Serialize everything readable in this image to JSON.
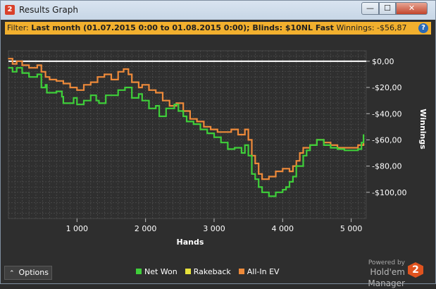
{
  "window": {
    "title": "Results Graph",
    "app_icon": "2",
    "controls": {
      "minimize": "—",
      "maximize": "☐",
      "close": "✕"
    }
  },
  "filter": {
    "prefix": "Filter:",
    "main": "Last month (01.07.2015 0:00 to 01.08.2015 0:00); Blinds: $10NL Fast",
    "winnings_label": "Winnings:",
    "winnings_value": "-$56,87",
    "help_icon": "?"
  },
  "footer": {
    "options_label": "Options",
    "powered_by": "Powered by",
    "brand": "Hold'em Manager",
    "logo": "2"
  },
  "colors": {
    "net_won": "#3fcf3a",
    "rakeback": "#e7e23c",
    "all_in_ev": "#ee8a3a",
    "zero_line": "#ffffff",
    "plot_bg": "#2f2f2f",
    "grid": "#555555",
    "filter_bg": "#f2b02e"
  },
  "chart_data": {
    "type": "line",
    "xlabel": "Hands",
    "ylabel": "Winnings",
    "xlim": [
      0,
      5220
    ],
    "ylim": [
      -120,
      8
    ],
    "x_ticks": [
      1000,
      2000,
      3000,
      4000,
      5000
    ],
    "x_tick_labels": [
      "1 000",
      "2 000",
      "3 000",
      "4 000",
      "5 000"
    ],
    "y_ticks": [
      0,
      -20,
      -40,
      -60,
      -80,
      -100
    ],
    "y_tick_labels": [
      "$0,00",
      "-$20,00",
      "-$40,00",
      "-$60,00",
      "-$80,00",
      "-$100,00"
    ],
    "grid": true,
    "legend_position": "bottom",
    "y_axis_position": "right",
    "series": [
      {
        "name": "Net Won",
        "color_key": "net_won",
        "x": [
          0,
          60,
          120,
          200,
          300,
          420,
          480,
          540,
          560,
          700,
          780,
          800,
          950,
          1000,
          1100,
          1200,
          1280,
          1320,
          1420,
          1600,
          1700,
          1800,
          1900,
          1950,
          2050,
          2150,
          2200,
          2300,
          2420,
          2480,
          2550,
          2600,
          2700,
          2800,
          2900,
          3000,
          3100,
          3200,
          3300,
          3400,
          3450,
          3500,
          3550,
          3600,
          3650,
          3700,
          3800,
          3900,
          4000,
          4050,
          4100,
          4150,
          4200,
          4300,
          4350,
          4400,
          4500,
          4600,
          4700,
          4800,
          4900,
          5000,
          5100,
          5150,
          5180
        ],
        "values": [
          -5,
          -8,
          -5,
          -9,
          -12,
          -10,
          -20,
          -18,
          -24,
          -23,
          -27,
          -32,
          -28,
          -33,
          -30,
          -26,
          -30,
          -32,
          -26,
          -22,
          -20,
          -28,
          -25,
          -30,
          -36,
          -34,
          -42,
          -36,
          -33,
          -38,
          -42,
          -46,
          -48,
          -52,
          -55,
          -58,
          -62,
          -67,
          -66,
          -70,
          -64,
          -72,
          -86,
          -90,
          -96,
          -100,
          -103,
          -100,
          -98,
          -96,
          -92,
          -88,
          -80,
          -72,
          -68,
          -64,
          -60,
          -64,
          -66,
          -67,
          -68,
          -68,
          -67,
          -62,
          -56
        ]
      },
      {
        "name": "Rakeback",
        "color_key": "rakeback",
        "x": [],
        "values": []
      },
      {
        "name": "All-In EV",
        "color_key": "all_in_ev",
        "x": [
          0,
          60,
          120,
          200,
          300,
          420,
          480,
          540,
          600,
          700,
          800,
          900,
          1000,
          1100,
          1200,
          1300,
          1400,
          1500,
          1600,
          1680,
          1750,
          1800,
          1900,
          1950,
          2050,
          2150,
          2250,
          2350,
          2450,
          2550,
          2650,
          2750,
          2850,
          2950,
          3050,
          3150,
          3250,
          3350,
          3450,
          3500,
          3550,
          3600,
          3650,
          3700,
          3800,
          3900,
          4000,
          4100,
          4150,
          4200,
          4250,
          4300,
          4400,
          4500,
          4600,
          4700,
          4800,
          4900,
          5000,
          5100,
          5150,
          5180
        ],
        "values": [
          2,
          -2,
          0,
          -3,
          -5,
          -3,
          -8,
          -12,
          -14,
          -15,
          -17,
          -20,
          -22,
          -18,
          -16,
          -12,
          -10,
          -14,
          -8,
          -6,
          -10,
          -16,
          -20,
          -18,
          -22,
          -24,
          -30,
          -34,
          -32,
          -38,
          -44,
          -46,
          -50,
          -52,
          -54,
          -54,
          -52,
          -56,
          -52,
          -60,
          -72,
          -78,
          -86,
          -90,
          -88,
          -84,
          -82,
          -84,
          -80,
          -76,
          -70,
          -66,
          -64,
          -60,
          -62,
          -64,
          -66,
          -66,
          -66,
          -64,
          -64,
          -62
        ]
      }
    ]
  }
}
